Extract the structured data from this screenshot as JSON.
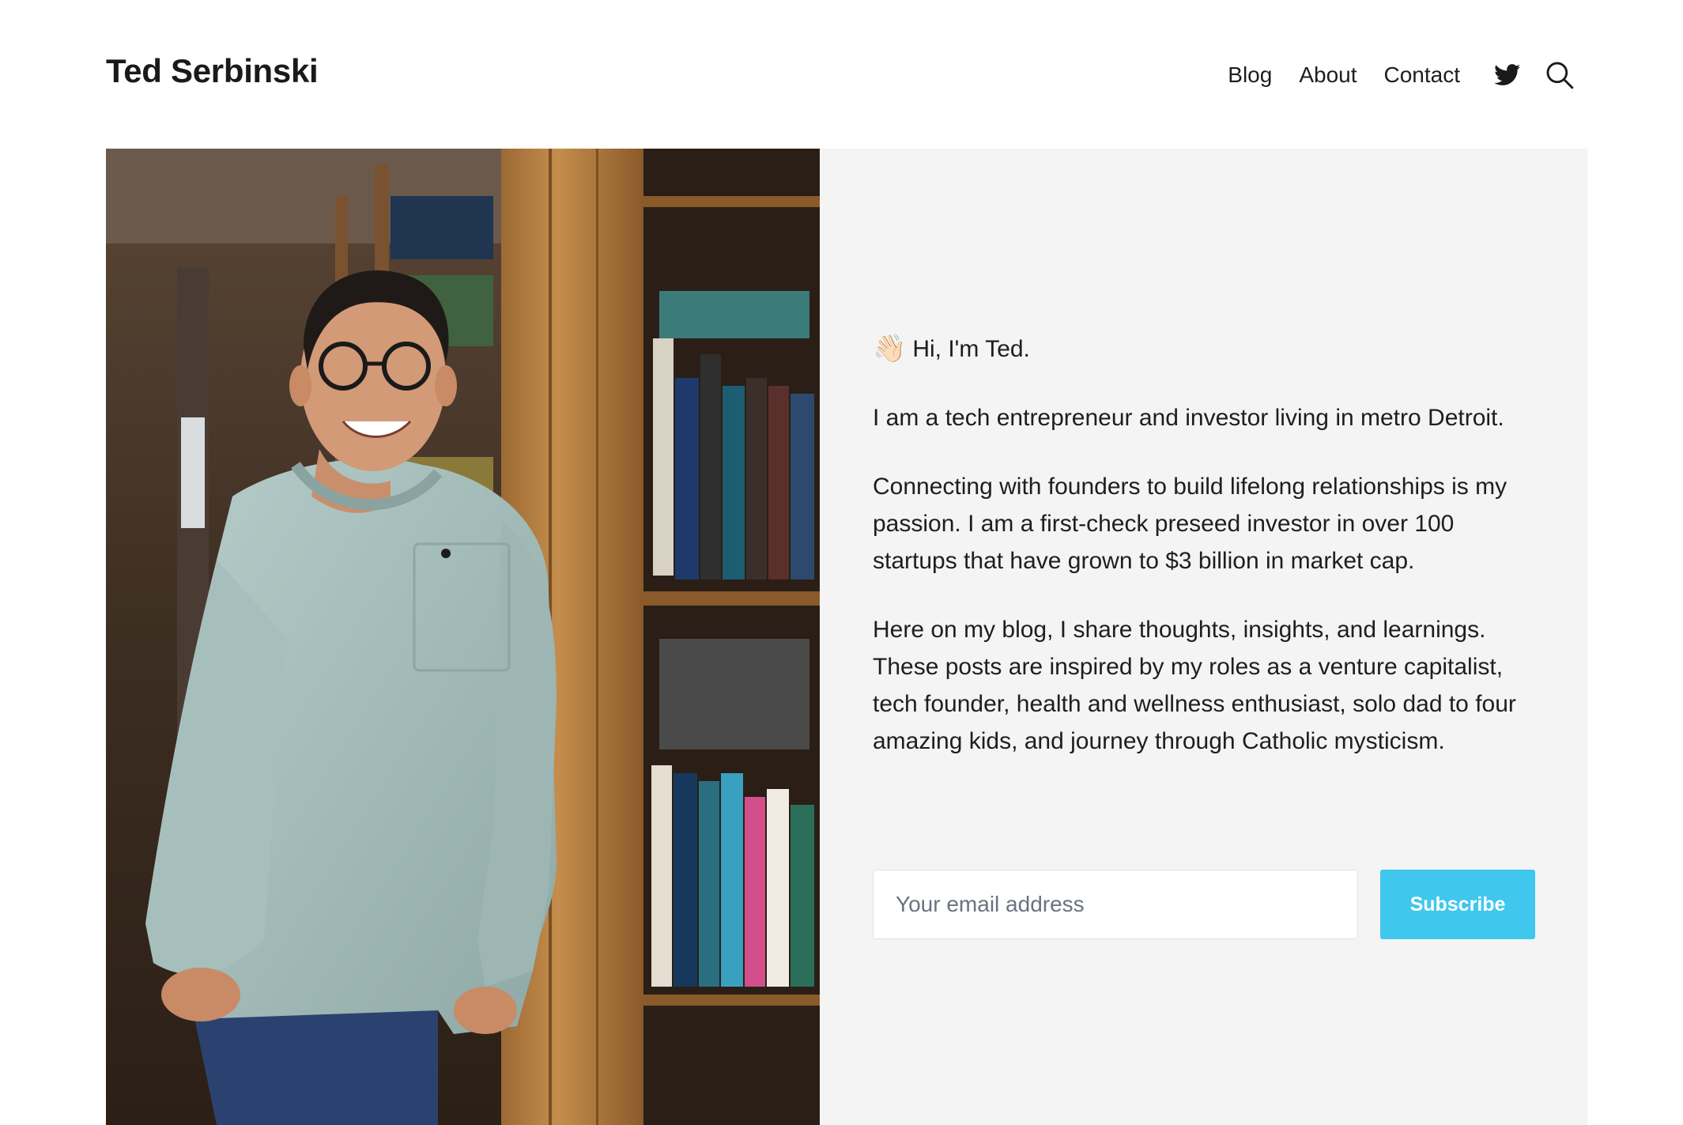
{
  "header": {
    "site_title": "Ted Serbinski",
    "nav": [
      {
        "label": "Blog"
      },
      {
        "label": "About"
      },
      {
        "label": "Contact"
      }
    ],
    "icons": [
      "twitter-icon",
      "search-icon"
    ]
  },
  "hero": {
    "photo_subject": "portrait-photo",
    "greeting_emoji": "👋🏻",
    "greeting": "Hi, I'm Ted.",
    "paragraphs": [
      "I am a tech entrepreneur and investor living in metro Detroit.",
      "Connecting with founders to build lifelong relationships is my passion. I am a first-check preseed investor in over 100 startups that have grown to $3 billion in market cap.",
      "Here on my blog, I share thoughts, insights, and learnings. These posts are inspired by my roles as a venture capitalist, tech founder, health and wellness enthusiast, solo dad to four amazing kids, and journey through Catholic mysticism."
    ],
    "subscribe": {
      "email_placeholder": "Your email address",
      "email_value": "",
      "button_label": "Subscribe"
    }
  },
  "colors": {
    "accent": "#3fc7ee",
    "panel_background": "#f4f4f4",
    "text": "#1e1e1e"
  }
}
